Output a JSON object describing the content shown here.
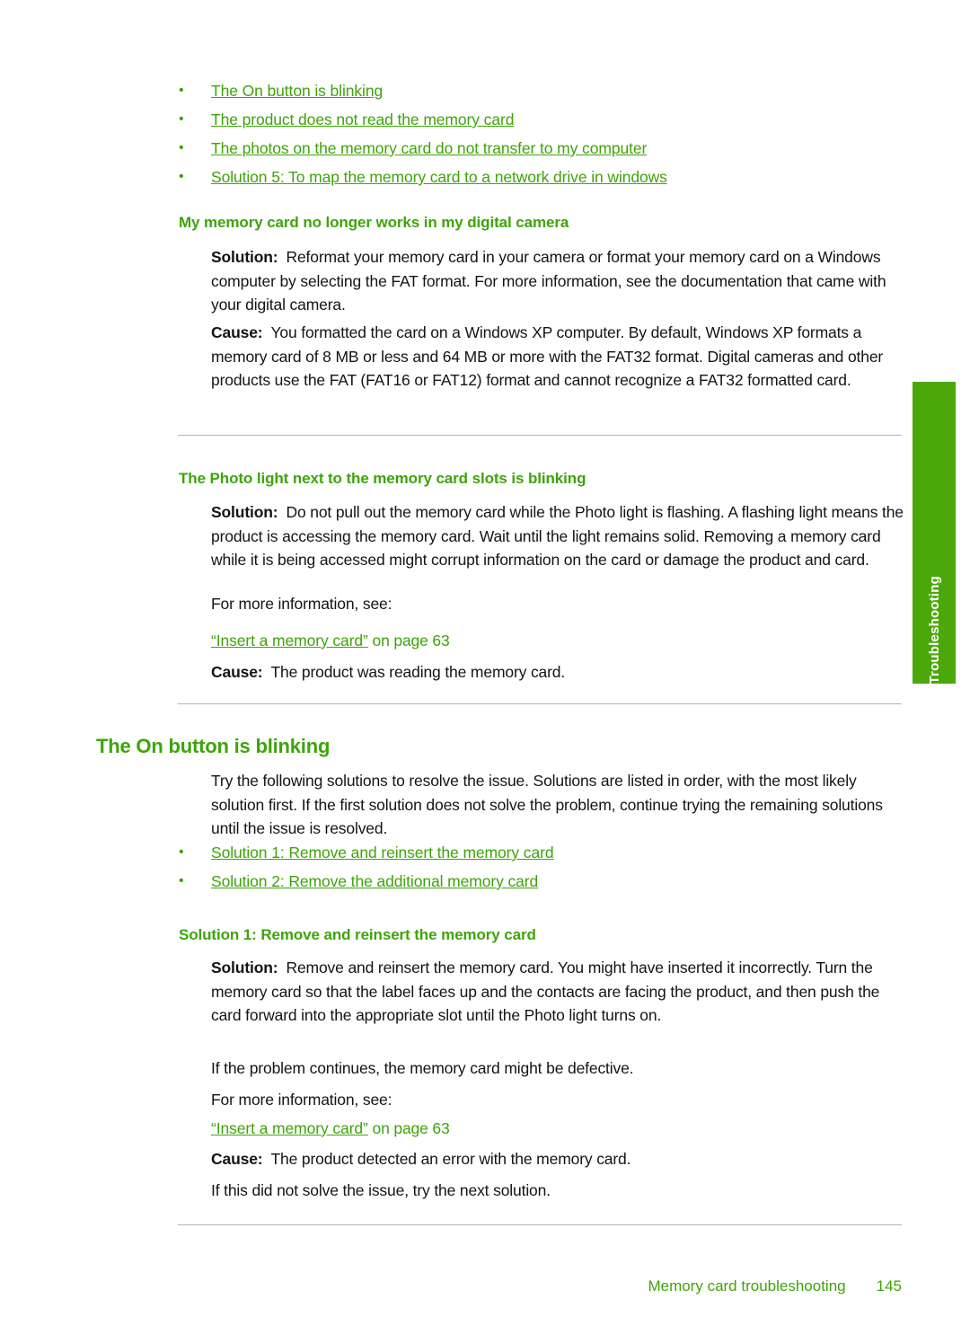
{
  "document": {
    "page_number": "145",
    "footer_title": "Memory card troubleshooting",
    "side_tab_label": "Troubleshooting",
    "accent_color": "#3ea40a",
    "tab_color": "#4ca80a"
  },
  "top_links": [
    {
      "bullet": "•",
      "text": "The On button is blinking"
    },
    {
      "bullet": "•",
      "text": "The product does not read the memory card"
    },
    {
      "bullet": "•",
      "text": "The photos on the memory card do not transfer to my computer"
    },
    {
      "bullet": "•",
      "text": "Solution 5: To map the memory card to a network drive in windows"
    }
  ],
  "section_camera": {
    "heading": "My memory card no longer works in my digital camera",
    "solution_label": "Solution:",
    "solution_text": "Reformat your memory card in your camera or format your memory card on a Windows computer by selecting the FAT format. For more information, see the documentation that came with your digital camera.",
    "cause_label": "Cause:",
    "cause_text": "You formatted the card on a Windows XP computer. By default, Windows XP formats a memory card of 8 MB or less and 64 MB or more with the FAT32 format. Digital cameras and other products use the FAT (FAT16 or FAT12) format and cannot recognize a FAT32 formatted card."
  },
  "section_photo_light": {
    "heading": "The Photo light next to the memory card slots is blinking",
    "solution_label": "Solution:",
    "solution_text": "Do not pull out the memory card while the Photo light is flashing. A flashing light means the product is accessing the memory card. Wait until the light remains solid. Removing a memory card while it is being accessed might corrupt information on the card or damage the product and card.",
    "more_info": "For more information, see:",
    "xref_quoted": "“Insert a memory card”",
    "xref_page": " on page 63",
    "cause_label": "Cause:",
    "cause_text": "The product was reading the memory card."
  },
  "section_on_button": {
    "heading": "The On button is blinking",
    "intro": "Try the following solutions to resolve the issue. Solutions are listed in order, with the most likely solution first. If the first solution does not solve the problem, continue trying the remaining solutions until the issue is resolved.",
    "links": [
      {
        "bullet": "•",
        "text": "Solution 1: Remove and reinsert the memory card"
      },
      {
        "bullet": "•",
        "text": "Solution 2: Remove the additional memory card"
      }
    ]
  },
  "section_solution1": {
    "heading": "Solution 1: Remove and reinsert the memory card",
    "solution_label": "Solution:",
    "solution_text": "Remove and reinsert the memory card. You might have inserted it incorrectly. Turn the memory card so that the label faces up and the contacts are facing the product, and then push the card forward into the appropriate slot until the Photo light turns on.",
    "defective_note": "If the problem continues, the memory card might be defective.",
    "more_info": "For more information, see:",
    "xref_quoted": "“Insert a memory card”",
    "xref_page": " on page 63",
    "cause_label": "Cause:",
    "cause_text": "The product detected an error with the memory card.",
    "next_note": "If this did not solve the issue, try the next solution."
  }
}
